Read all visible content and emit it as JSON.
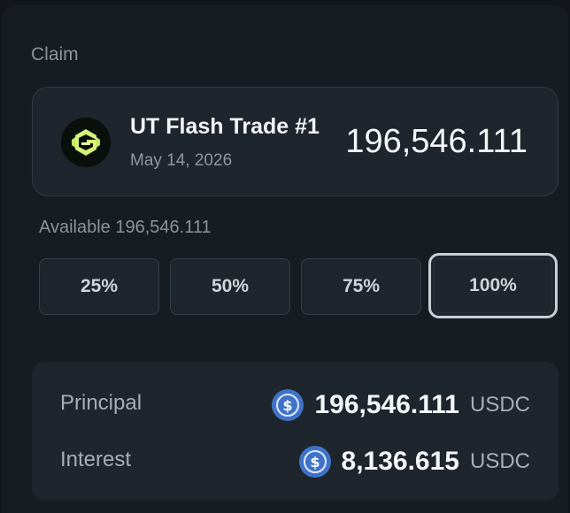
{
  "claim": {
    "title": "Claim"
  },
  "trade": {
    "name": "UT Flash Trade #1",
    "date": "May 14, 2026",
    "amount": "196,546.111",
    "logo_icon": "ut-flash-trade-logo"
  },
  "available": {
    "text": "Available 196,546.111"
  },
  "percent_options": [
    {
      "label": "25%",
      "selected": false
    },
    {
      "label": "50%",
      "selected": false
    },
    {
      "label": "75%",
      "selected": false
    },
    {
      "label": "100%",
      "selected": true
    }
  ],
  "summary": {
    "principal": {
      "label": "Principal",
      "amount": "196,546.111",
      "unit": "USDC",
      "icon": "usdc-icon"
    },
    "interest": {
      "label": "Interest",
      "amount": "8,136.615",
      "unit": "USDC",
      "icon": "usdc-icon"
    }
  },
  "colors": {
    "background": "#13171c",
    "panel": "#171c22",
    "card": "#1f252c",
    "usdc_blue": "#3f73c8",
    "logo_green": "#d6f27a"
  }
}
